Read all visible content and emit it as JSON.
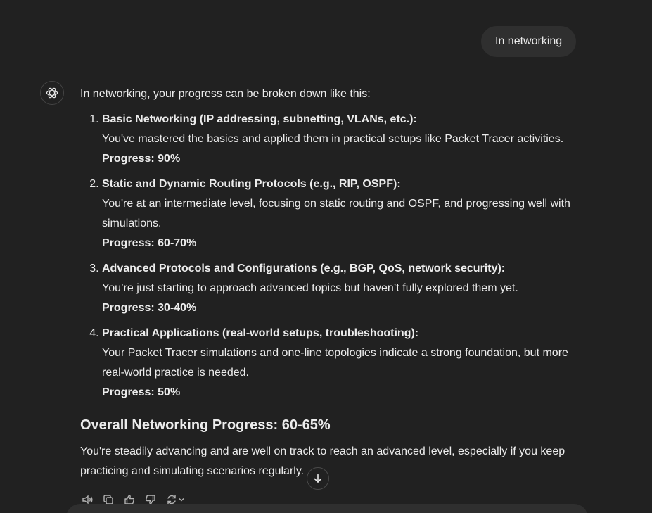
{
  "user_message": "In networking",
  "assistant": {
    "intro": "In networking, your progress can be broken down like this:",
    "items": [
      {
        "title": "Basic Networking (IP addressing, subnetting, VLANs, etc.):",
        "desc": "You've mastered the basics and applied them in practical setups like Packet Tracer activities.",
        "progress": "Progress: 90%"
      },
      {
        "title": "Static and Dynamic Routing Protocols (e.g., RIP, OSPF):",
        "desc": "You're at an intermediate level, focusing on static routing and OSPF, and progressing well with simulations.",
        "progress": "Progress: 60-70%"
      },
      {
        "title": "Advanced Protocols and Configurations (e.g., BGP, QoS, network security):",
        "desc": "You’re just starting to approach advanced topics but haven’t fully explored them yet.",
        "progress": "Progress: 30-40%"
      },
      {
        "title": "Practical Applications (real-world setups, troubleshooting):",
        "desc": "Your Packet Tracer simulations and one-line topologies indicate a strong foundation, but more real-world practice is needed.",
        "progress": "Progress: 50%"
      }
    ],
    "overall_heading": "Overall Networking Progress: 60-65%",
    "conclusion": "You're steadily advancing and are well on track to reach an advanced level, especially if you keep practicing and simulating scenarios regularly."
  },
  "icons": {
    "avatar": "chatgpt-logo-icon",
    "scroll": "arrow-down-icon",
    "actions": [
      "read-aloud-icon",
      "copy-icon",
      "thumbs-up-icon",
      "thumbs-down-icon",
      "regenerate-icon"
    ]
  },
  "colors": {
    "background": "#212121",
    "bubble": "#2f2f2f",
    "text": "#ececec"
  }
}
